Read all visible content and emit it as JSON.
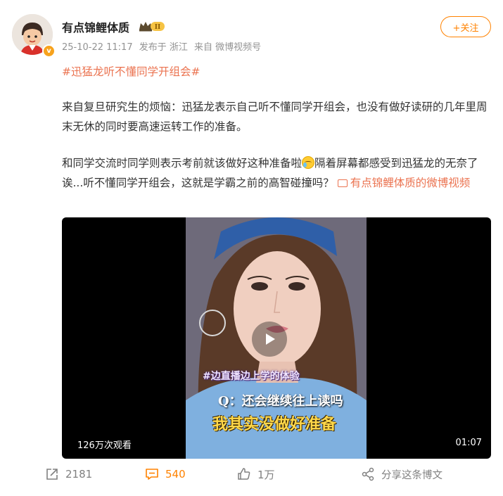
{
  "post": {
    "username": "有点锦鲤体质",
    "verified_badge": "v",
    "level_badge": "II",
    "timestamp": "25-10-22 11:17",
    "location": "发布于 浙江",
    "source": "来自 微博视频号",
    "follow_label": "+关注",
    "hashtag": "#迅猛龙听不懂同学开组会#",
    "paragraph1": "来自复旦研究生的烦恼：迅猛龙表示自己听不懂同学开组会，也没有做好读研的几年里周末无休的同时要高速运转工作的准备。",
    "paragraph2_a": "和同学交流时同学则表示考前就该做好这种准备啦",
    "paragraph2_b": "隔着屏幕都感受到迅猛龙的无奈了诶...听不懂同学开组会，这就是学霸之前的高智碰撞吗？",
    "video_link": "有点锦鲤体质的微博视频"
  },
  "video": {
    "caption_tag": "#边直播边上学的体验",
    "caption_question": "Q：还会继续往上读吗",
    "caption_answer": "我其实没做好准备",
    "views": "126万次观看",
    "duration": "01:07"
  },
  "actions": {
    "repost_count": "2181",
    "comment_count": "540",
    "like_count": "1万",
    "share_label": "分享这条博文"
  },
  "colors": {
    "accent": "#ff8200",
    "link": "#eb7350",
    "meta": "#939393"
  }
}
